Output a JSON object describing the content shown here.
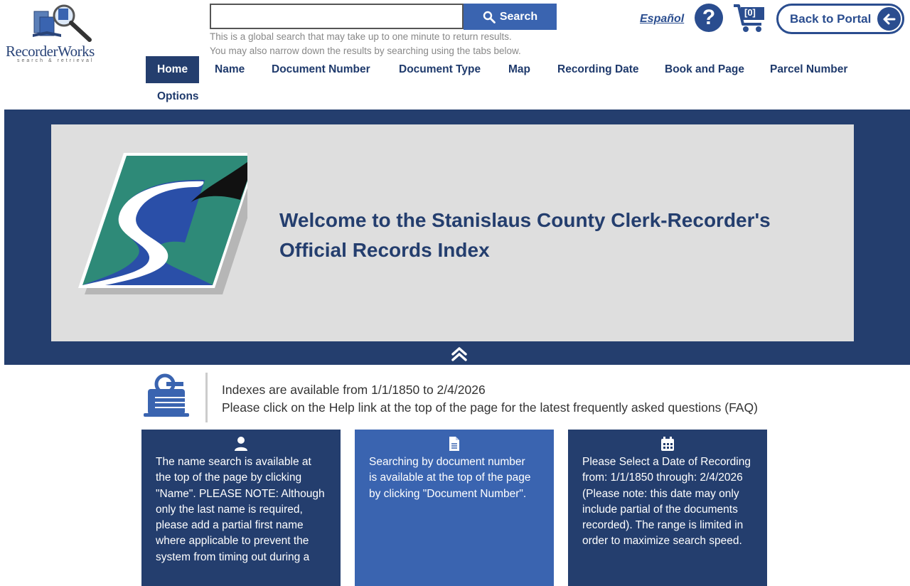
{
  "header": {
    "logo_text": "RecorderWorks",
    "logo_tagline": "search & retrieval",
    "search": {
      "placeholder": "",
      "button_label": "Search",
      "hint_line1": "This is a global search that may take up to one minute to return results.",
      "hint_line2": "You may also narrow down the results by searching using the tabs below."
    },
    "language_link": "Español",
    "help_label": "?",
    "cart_count": "[0]",
    "portal_button": "Back to Portal"
  },
  "nav": {
    "items": [
      {
        "label": "Home",
        "active": true
      },
      {
        "label": "Name"
      },
      {
        "label": "Document Number"
      },
      {
        "label": "Document Type"
      },
      {
        "label": "Map"
      },
      {
        "label": "Recording Date"
      },
      {
        "label": "Book and Page"
      },
      {
        "label": "Parcel Number"
      },
      {
        "label": "Options"
      }
    ]
  },
  "banner": {
    "welcome_line1": "Welcome to the Stanislaus County Clerk-Recorder's",
    "welcome_line2": "Official Records Index"
  },
  "info": {
    "line1": "Indexes are available from 1/1/1850 to 2/4/2026",
    "line2": "Please click on the Help link at the top of the page for the latest frequently asked questions (FAQ)"
  },
  "cards": [
    {
      "icon": "user-icon",
      "lines": [
        "The name search is available at",
        "the top of the page by clicking",
        "\"Name\". PLEASE NOTE: Although",
        "only the last name is required,",
        "please add a partial first name",
        "where applicable to prevent the",
        "system from timing out during a"
      ]
    },
    {
      "icon": "document-icon",
      "lines": [
        "Searching by document number",
        "is available at the top of the page",
        "by clicking \"Document Number\"."
      ]
    },
    {
      "icon": "calendar-icon",
      "lines": [
        "Please Select a Date of Recording",
        "from: 1/1/1850 through: 2/4/2026",
        "(Please note: this date may only",
        "include partial of the documents",
        "recorded). The range is limited in",
        "order to maximize search speed."
      ]
    }
  ],
  "colors": {
    "navy": "#243e6e",
    "accent_blue": "#3a64b0",
    "banner_inner": "#dedede",
    "teal": "#2e8a78"
  }
}
